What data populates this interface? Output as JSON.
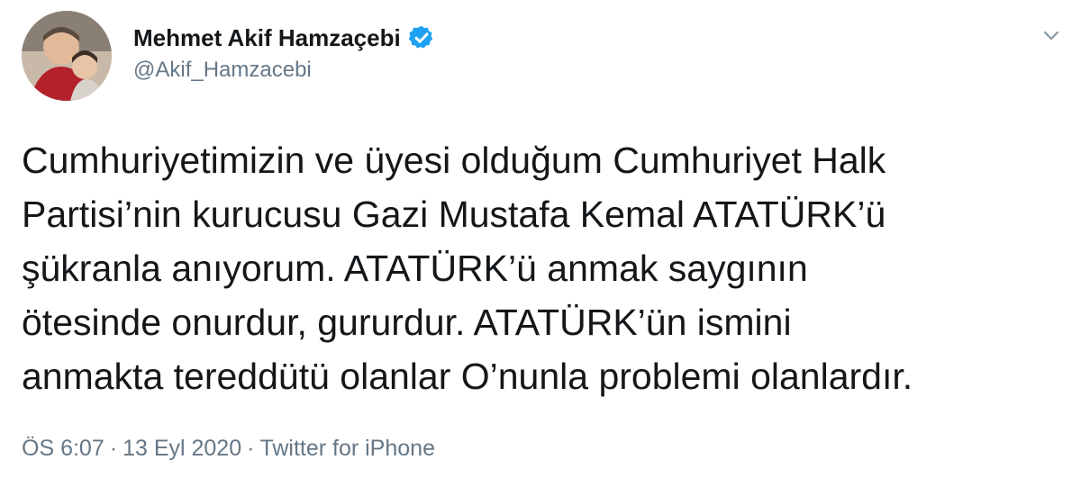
{
  "user": {
    "display_name": "Mehmet Akif Hamzaçebi",
    "handle": "@Akif_Hamzacebi",
    "verified": true
  },
  "tweet": {
    "lines": [
      "Cumhuriyetimizin ve üyesi olduğum Cumhuriyet Halk",
      "Partisi’nin kurucusu Gazi Mustafa Kemal ATATÜRK’ü",
      "şükranla anıyorum. ATATÜRK’ü anmak saygının",
      "ötesinde onurdur, gururdur. ATATÜRK’ün ismini",
      "anmakta tereddütü olanlar O’nunla problemi olanlardır."
    ]
  },
  "meta": {
    "time": "ÖS 6:07",
    "separator": "·",
    "date": "13 Eyl 2020",
    "source": "Twitter for iPhone"
  },
  "icons": {
    "verified": "verified-badge-icon",
    "more": "chevron-down-icon"
  },
  "colors": {
    "text": "#14171a",
    "secondary": "#657786",
    "verified": "#1da1f2"
  }
}
